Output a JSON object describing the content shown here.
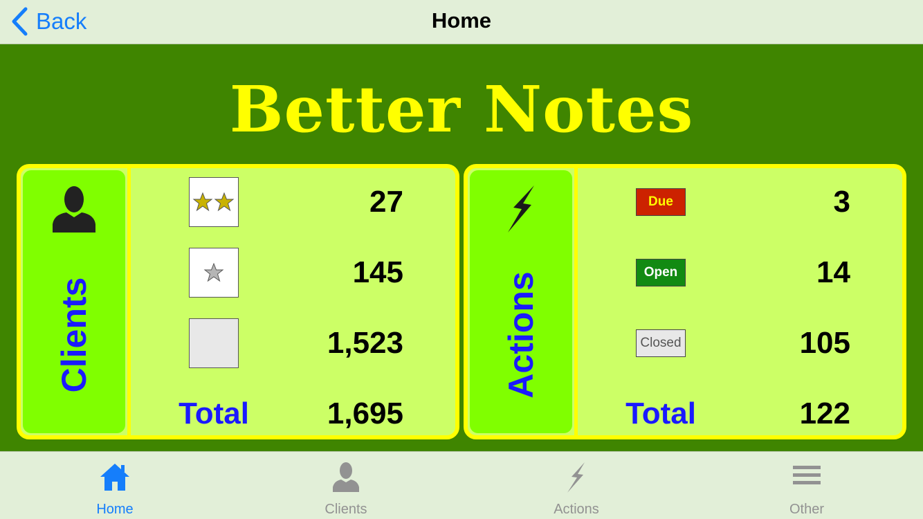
{
  "nav": {
    "back_label": "Back",
    "title": "Home"
  },
  "app_title": "Better Notes",
  "clients": {
    "label": "Clients",
    "rows": [
      {
        "indicator": "two-stars",
        "count": "27"
      },
      {
        "indicator": "one-star",
        "count": "145"
      },
      {
        "indicator": "no-stars",
        "count": "1,523"
      }
    ],
    "total_label": "Total",
    "total": "1,695"
  },
  "actions": {
    "label": "Actions",
    "rows": [
      {
        "status": "Due",
        "count": "3"
      },
      {
        "status": "Open",
        "count": "14"
      },
      {
        "status": "Closed",
        "count": "105"
      }
    ],
    "total_label": "Total",
    "total": "122"
  },
  "tabs": [
    {
      "label": "Home",
      "icon": "home-icon",
      "active": true
    },
    {
      "label": "Clients",
      "icon": "person-icon",
      "active": false
    },
    {
      "label": "Actions",
      "icon": "lightning-icon",
      "active": false
    },
    {
      "label": "Other",
      "icon": "menu-icon",
      "active": false
    }
  ],
  "colors": {
    "background": "#3f8500",
    "title": "#ffff00",
    "panel": "#ccff66",
    "panel_border": "#ffff00",
    "side": "#80ff00",
    "side_label": "#1a1aff",
    "accent": "#157efb",
    "due": "#cc2200",
    "open": "#128a12",
    "closed": "#e8e8e8"
  }
}
